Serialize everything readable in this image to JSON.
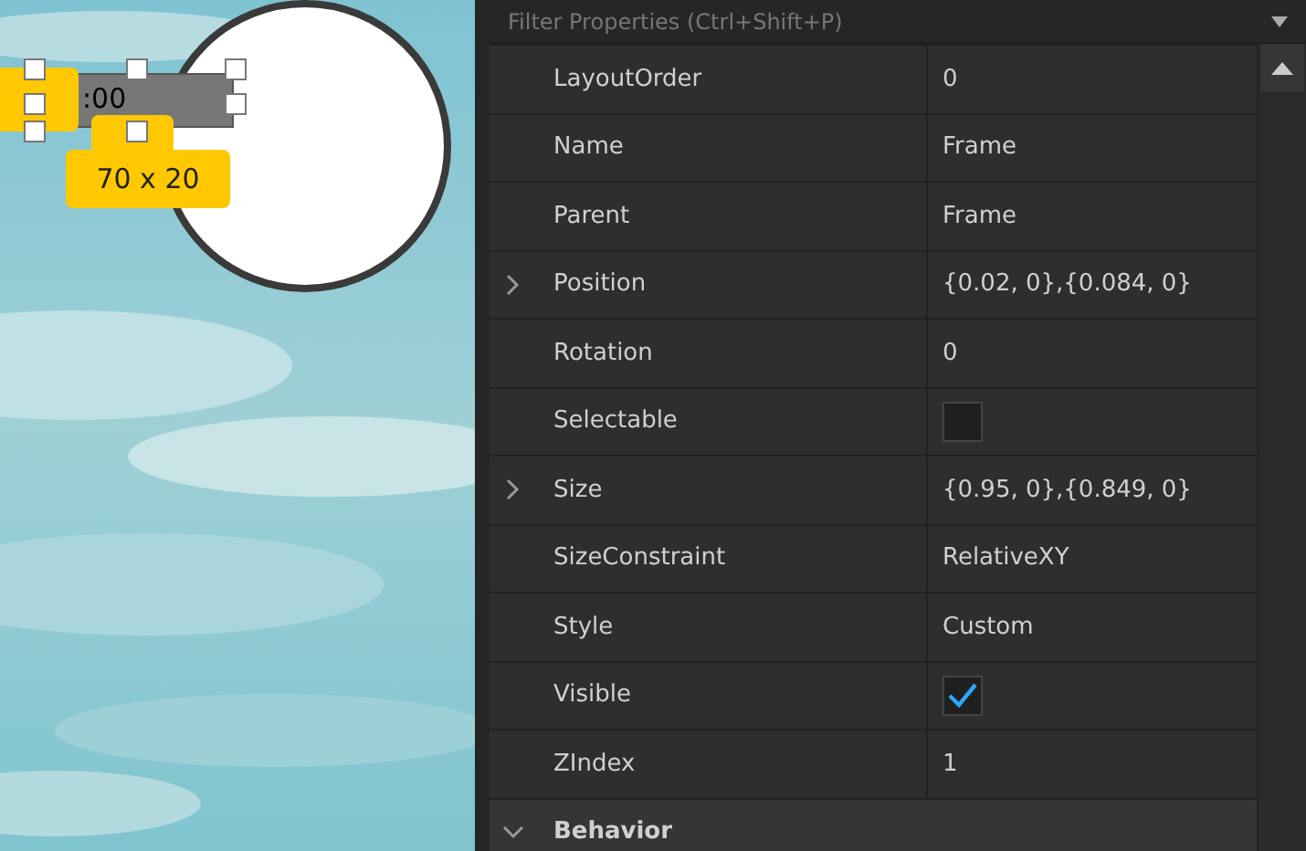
{
  "viewport": {
    "frame_text": ":00",
    "size_tooltip": "70 x 20"
  },
  "filter": {
    "placeholder": "Filter Properties (Ctrl+Shift+P)"
  },
  "properties": [
    {
      "name": "LayoutOrder",
      "kind": "text",
      "value": "0"
    },
    {
      "name": "Name",
      "kind": "text",
      "value": "Frame"
    },
    {
      "name": "Parent",
      "kind": "text",
      "value": "Frame"
    },
    {
      "name": "Position",
      "kind": "text",
      "value": "{0.02, 0},{0.084, 0}",
      "expanded": false
    },
    {
      "name": "Rotation",
      "kind": "text",
      "value": "0"
    },
    {
      "name": "Selectable",
      "kind": "checkbox",
      "checked": false
    },
    {
      "name": "Size",
      "kind": "text",
      "value": "{0.95, 0},{0.849, 0}",
      "expanded": false
    },
    {
      "name": "SizeConstraint",
      "kind": "text",
      "value": "RelativeXY"
    },
    {
      "name": "Style",
      "kind": "text",
      "value": "Custom"
    },
    {
      "name": "Visible",
      "kind": "checkbox",
      "checked": true
    },
    {
      "name": "ZIndex",
      "kind": "text",
      "value": "1"
    }
  ],
  "sections": [
    {
      "title": "Behavior",
      "expanded": true
    }
  ]
}
